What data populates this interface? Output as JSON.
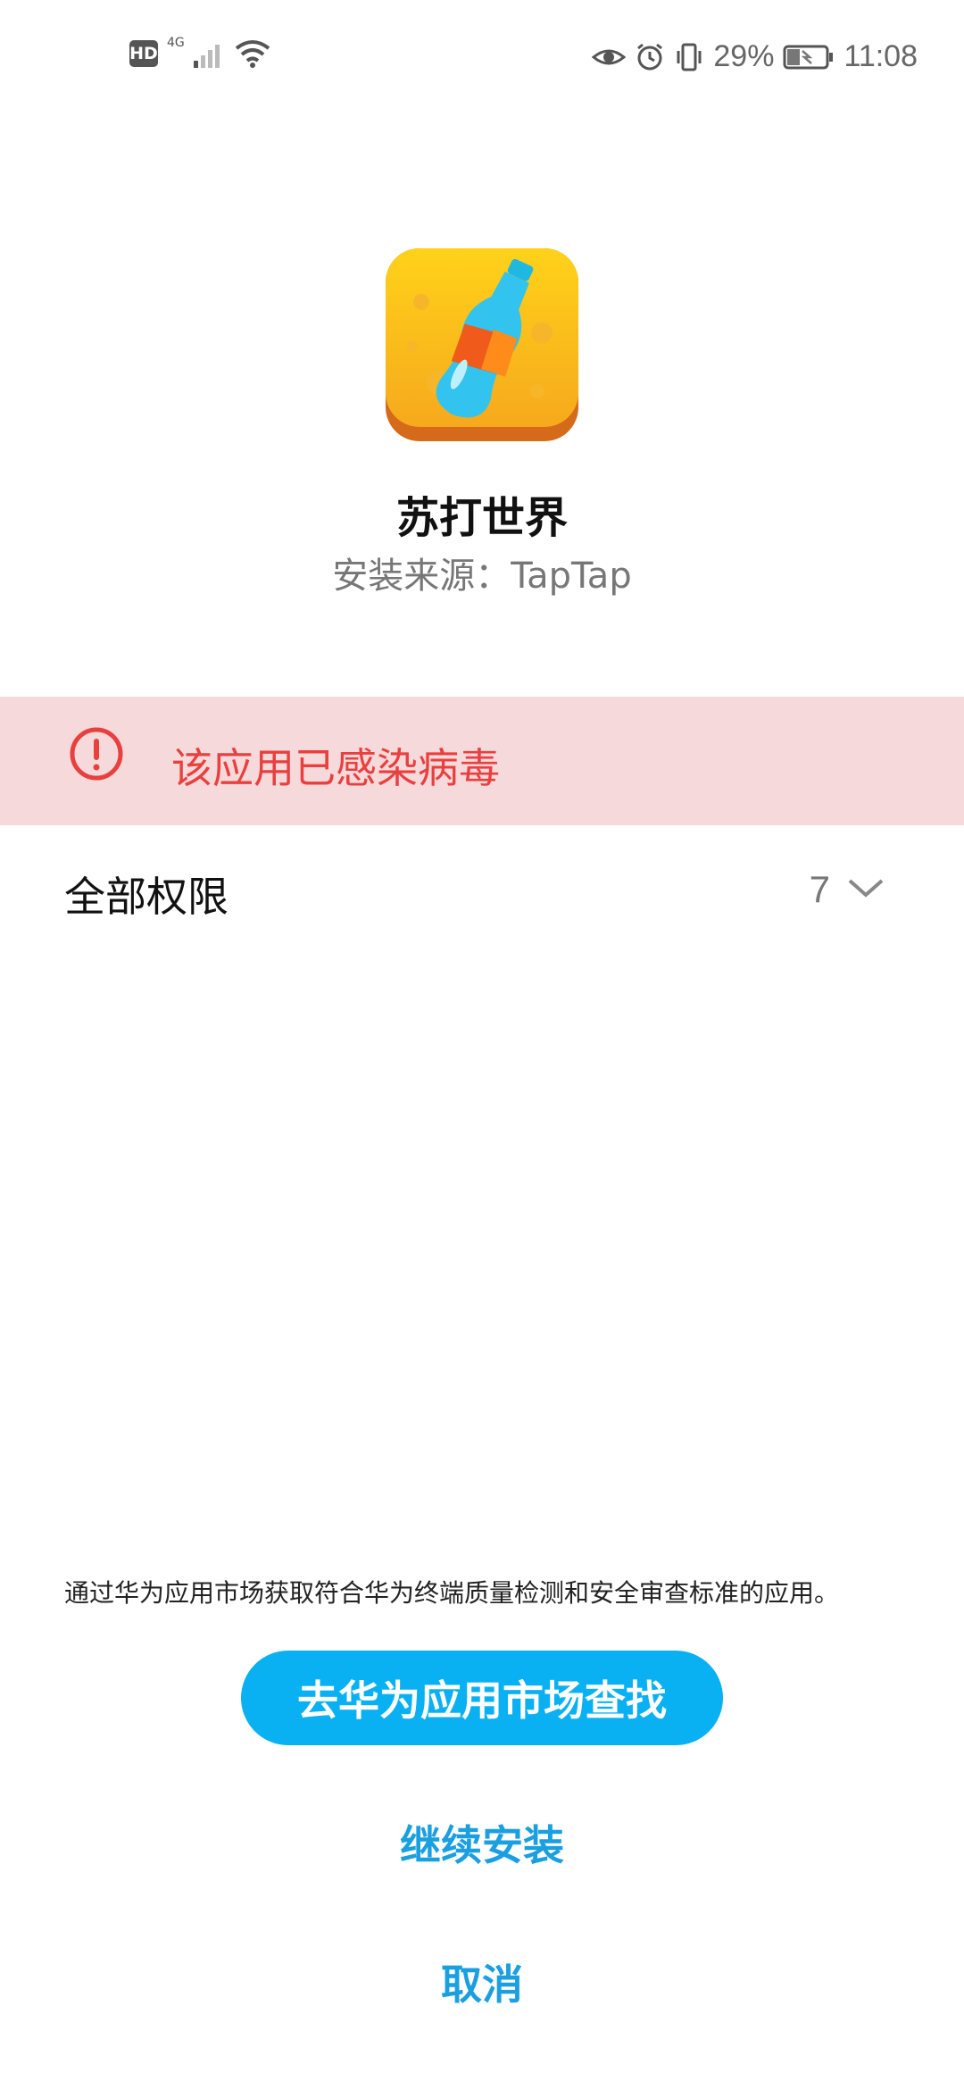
{
  "status_bar": {
    "hd": "HD",
    "network": "4G",
    "battery_percent": "29%",
    "time": "11:08",
    "icons": [
      "hd-icon",
      "signal-icon",
      "wifi-icon",
      "eye-icon",
      "alarm-icon",
      "vibrate-icon",
      "battery-icon"
    ]
  },
  "app": {
    "name": "苏打世界",
    "source": "安装来源：TapTap",
    "icon": "soda-bottle-app-icon"
  },
  "warning": {
    "text": "该应用已感染病毒",
    "icon": "alert-circle-icon",
    "color": "#e8403f",
    "background": "#f6d9da"
  },
  "permissions": {
    "label": "全部权限",
    "count": "7",
    "icon": "chevron-down-icon"
  },
  "footer": {
    "notice": "通过华为应用市场获取符合华为终端质量检测和安全审查标准的应用。",
    "primary_button": "去华为应用市场查找",
    "continue_button": "继续安装",
    "cancel_button": "取消",
    "accent": "#0ab1f2"
  }
}
